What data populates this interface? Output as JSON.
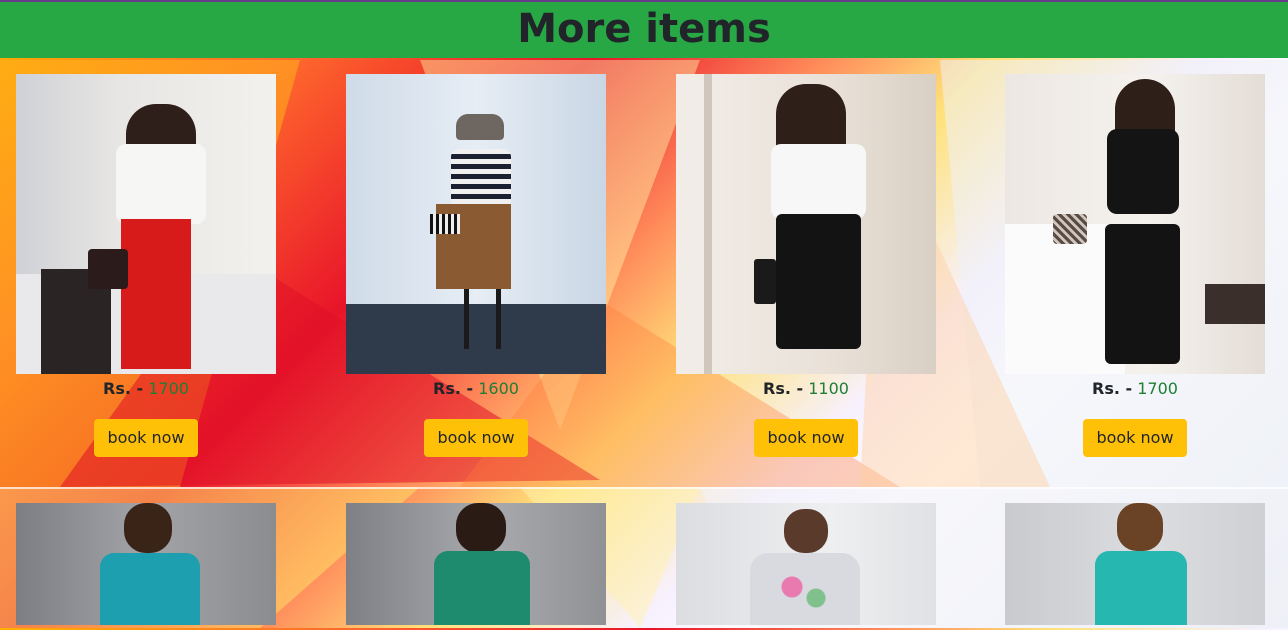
{
  "header": {
    "title": "More items"
  },
  "row1": [
    {
      "currency": "Rs. -",
      "price": "1700",
      "button": "book now"
    },
    {
      "currency": "Rs. -",
      "price": "1600",
      "button": "book now"
    },
    {
      "currency": "Rs. -",
      "price": "1100",
      "button": "book now"
    },
    {
      "currency": "Rs. -",
      "price": "1700",
      "button": "book now"
    }
  ],
  "colors": {
    "header": "#28a745",
    "button": "#ffc107",
    "price": "#1e7e34"
  }
}
